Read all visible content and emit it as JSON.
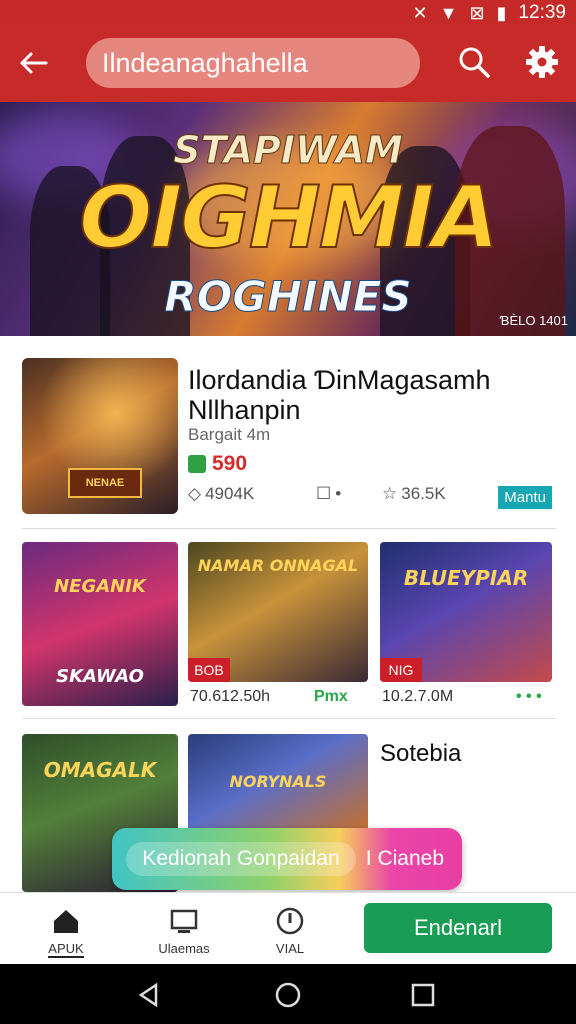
{
  "status_bar": {
    "time": "12:39",
    "icons": [
      "mute-icon",
      "wifi-icon",
      "no-sim-icon",
      "battery-icon"
    ]
  },
  "header": {
    "search_text": "Ilndeanaghahella",
    "icons": [
      "back-arrow-icon",
      "search-icon",
      "settings-icon"
    ]
  },
  "hero": {
    "title_top": "STAPIWAM",
    "title_main": "OIGHMIA",
    "title_bottom": "ROGHINES",
    "caption": "ƁЀLO 1401"
  },
  "featured": {
    "title": "Ilordandia ƊinMagasamh Nllhanpin",
    "subtitle": "Bargait 4m",
    "price": "590",
    "stats": {
      "likes": "4904K",
      "comments": "•",
      "stars": "36.5K"
    },
    "badge": "Mantu"
  },
  "grid_row1": [
    {
      "art_text": "NEGANIK",
      "tag": "",
      "bottom_text": "SKAWAO",
      "meta": "70.612.50h"
    },
    {
      "art_text": "NAMAR ONNAGAL",
      "tag": "BOB",
      "bottom_text": "",
      "meta": "Pmx"
    },
    {
      "art_text": "BLUEYPIAR",
      "tag": "NIG",
      "bottom_text": "",
      "meta": "10.2.7.0M",
      "extra": "• • •"
    }
  ],
  "grid_row2": [
    {
      "art_text": "OMAGALK",
      "label": ""
    },
    {
      "art_text": "NORYNALS",
      "label": ""
    },
    {
      "title": "Sotebia"
    }
  ],
  "banner": {
    "left_text": "Kedionah Gonpaidan",
    "right_text": "I Cianeb"
  },
  "bottom_nav": [
    {
      "label": "APUK",
      "icon": "home-icon"
    },
    {
      "label": "Ulaemas",
      "icon": "monitor-icon"
    },
    {
      "label": "VIAL",
      "icon": "alert-circle-icon"
    }
  ],
  "cta": {
    "label": "Endenarl"
  },
  "system_nav": [
    "back-triangle-icon",
    "home-circle-icon",
    "recents-square-icon"
  ],
  "colors": {
    "accent": "#c62b29",
    "cta": "#199d55",
    "price": "#d72b2b",
    "badge": "#17a7b3"
  }
}
